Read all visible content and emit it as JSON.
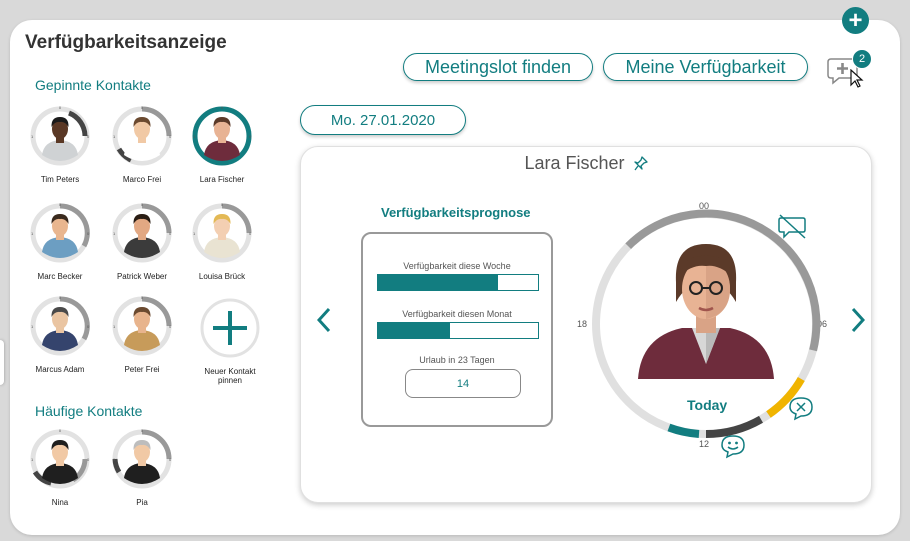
{
  "page": {
    "title": "Verfügbarkeitsanzeige"
  },
  "sections": {
    "pinned": "Gepinnte Kontakte",
    "frequent": "Häufige Kontakte"
  },
  "buttons": {
    "meeting": "Meetingslot finden",
    "availability": "Meine Verfügbarkeit",
    "date": "Mo. 27.01.2020"
  },
  "notifications": {
    "count": "2"
  },
  "pinned_contacts": [
    {
      "name": "Tim Peters",
      "skin": "#5a3825",
      "shirt": "#cfd2d4",
      "hair": "#1b1b1b"
    },
    {
      "name": "Marco Frei",
      "skin": "#f1c9a5",
      "shirt": "#ffffff",
      "hair": "#6b4a30"
    },
    {
      "name": "Lara Fischer",
      "skin": "#e8b394",
      "shirt": "#6e2c3c",
      "hair": "#5b3a29"
    },
    {
      "name": "Marc Becker",
      "skin": "#e9b68f",
      "shirt": "#6c9ec2",
      "hair": "#3a2a1e"
    },
    {
      "name": "Patrick Weber",
      "skin": "#e2a883",
      "shirt": "#3b3b3b",
      "hair": "#2a1d14"
    },
    {
      "name": "Louisa Brück",
      "skin": "#f3cfb2",
      "shirt": "#e9e3d2",
      "hair": "#e3b955"
    },
    {
      "name": "Marcus Adam",
      "skin": "#eac5a2",
      "shirt": "#35446d",
      "hair": "#4a4a4a"
    },
    {
      "name": "Peter Frei",
      "skin": "#e8b48d",
      "shirt": "#c79b5a",
      "hair": "#6b4a30"
    }
  ],
  "add_contact": {
    "label_line1": "Neuer Kontakt",
    "label_line2": "pinnen"
  },
  "frequent_contacts": [
    {
      "name": "Nina",
      "skin": "#f1c9a5",
      "shirt": "#1f1f1f",
      "hair": "#1f1f1f"
    },
    {
      "name": "Pia",
      "skin": "#f1c9a5",
      "shirt": "#1f1f1f",
      "hair": "#bdbdbd"
    }
  ],
  "ring_digits": {
    "top": "0",
    "left": "1",
    "right": "0"
  },
  "detail": {
    "name": "Lara Fischer",
    "prognosis_title": "Verfügbarkeitsprognose",
    "week_label": "Verfügbarkeit diese Woche",
    "week_value": 0.75,
    "month_label": "Verfügbarkeit diesen Monat",
    "month_value": 0.45,
    "vacation_label": "Urlaub in 23 Tagen",
    "vacation_value": "14",
    "today_label": "Today",
    "hours": {
      "top": "00",
      "right": "06",
      "bottom": "12",
      "left": "18"
    }
  },
  "colors": {
    "accent": "#127d80",
    "warning": "#f0b400",
    "dark": "#444444",
    "ring": "#e0e0e0",
    "busy": "#999999"
  }
}
